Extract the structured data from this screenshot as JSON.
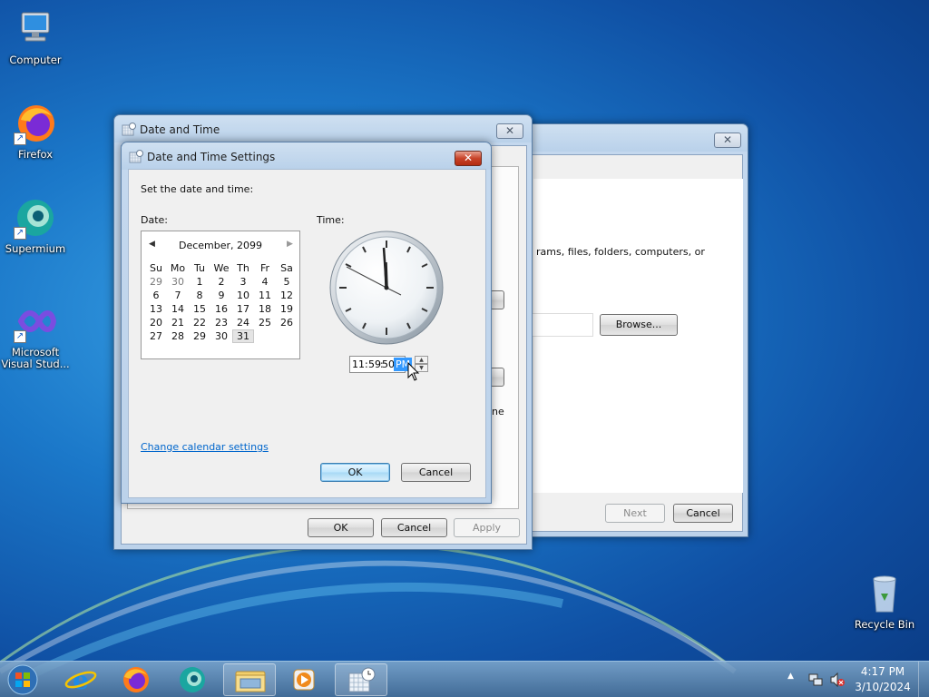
{
  "desktop": {
    "icons": [
      {
        "label": "Computer"
      },
      {
        "label": "Firefox"
      },
      {
        "label": "Supermium"
      },
      {
        "label": "Microsoft Visual Stud..."
      },
      {
        "label": "Recycle Bin"
      }
    ]
  },
  "back_window": {
    "text_fragment_1": "rams, files, folders, computers, or",
    "text_fragment_2": "ne",
    "browse_label": "Browse...",
    "next_label": "Next",
    "cancel_label": "Cancel"
  },
  "date_time_window": {
    "title": "Date and Time",
    "ok_label": "OK",
    "cancel_label": "Cancel",
    "apply_label": "Apply"
  },
  "settings_dialog": {
    "title": "Date and Time Settings",
    "prompt": "Set the date and time:",
    "date_label": "Date:",
    "time_label": "Time:",
    "calendar": {
      "month_year": "December, 2099",
      "weekdays": [
        "Su",
        "Mo",
        "Tu",
        "We",
        "Th",
        "Fr",
        "Sa"
      ],
      "weeks": [
        [
          "29",
          "30",
          "1",
          "2",
          "3",
          "4",
          "5"
        ],
        [
          "6",
          "7",
          "8",
          "9",
          "10",
          "11",
          "12"
        ],
        [
          "13",
          "14",
          "15",
          "16",
          "17",
          "18",
          "19"
        ],
        [
          "20",
          "21",
          "22",
          "23",
          "24",
          "25",
          "26"
        ],
        [
          "27",
          "28",
          "29",
          "30",
          "31",
          "",
          ""
        ]
      ],
      "selected_day": "31"
    },
    "time": {
      "hours": "11",
      "minutes": "59",
      "seconds": "50",
      "ampm": "PM"
    },
    "change_calendar_link": "Change calendar settings",
    "ok_label": "OK",
    "cancel_label": "Cancel"
  },
  "taskbar": {
    "clock_time": "4:17 PM",
    "clock_date": "3/10/2024"
  },
  "colors": {
    "accent_selection": "#3399ff",
    "link": "#0066cc"
  }
}
